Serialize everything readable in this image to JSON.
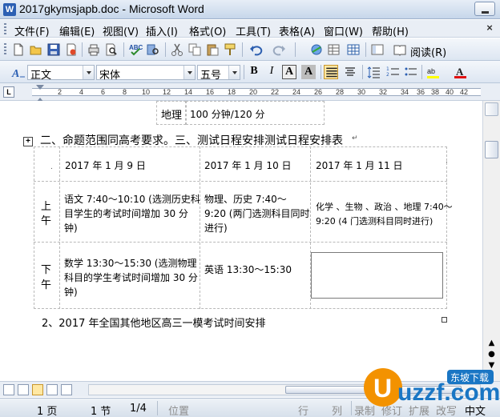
{
  "window": {
    "title": "2017gkymsjapb.doc - Microsoft Word",
    "app_icon": "W"
  },
  "menu": {
    "items": [
      "文件(F)",
      "编辑(E)",
      "视图(V)",
      "插入(I)",
      "格式(O)",
      "工具(T)",
      "表格(A)",
      "窗口(W)",
      "帮助(H)"
    ],
    "close": "×"
  },
  "toolbar": {
    "read_label": "阅读(R)"
  },
  "format_bar": {
    "style": "正文",
    "font": "宋体",
    "size": "五号",
    "bold": "B",
    "italic": "I",
    "font_color_label": "A",
    "char_shade_label": "A"
  },
  "ruler": {
    "ticks": [
      "2",
      "4",
      "6",
      "8",
      "10",
      "12",
      "14",
      "16",
      "18",
      "20",
      "22",
      "24",
      "26",
      "28",
      "30",
      "32",
      "34",
      "36",
      "38",
      "40",
      "42"
    ],
    "tab_marker": "L"
  },
  "document": {
    "prev_row": {
      "subject": "地理",
      "time": "100 分钟/120 分"
    },
    "heading": "二、命题范围同高考要求。三、测试日程安排测试日程安排表",
    "table_dates": [
      "2017 年 1 月 9 日",
      "2017 年 1 月 10 日",
      "2017 年 1 月 11 日"
    ],
    "morning_label": [
      "上",
      "午"
    ],
    "morning": [
      [
        "语文 7:40～10:10 (选测历史科",
        "目学生的考试时间增加 30 分",
        "钟)"
      ],
      [
        "物理、历史 7:40～",
        "9:20 (两门选测科目同时",
        "进行)"
      ],
      [
        "化学 、生物 、政治 、地理 7:40～",
        "9:20 (4 门选测科目同时进行)"
      ]
    ],
    "afternoon_label": [
      "下",
      "午"
    ],
    "afternoon": [
      [
        "数学 13:30～15:30 (选测物理",
        "科目的学生考试时间增加 30 分",
        "钟)"
      ],
      [
        "英语 13:30～15:30"
      ]
    ],
    "section2": "2、2017 年全国其他地区高三一模考试时间安排"
  },
  "status_bar": {
    "page": "1 页",
    "section": "1 节",
    "page_of": "1/4",
    "position": "位置",
    "line": "行",
    "column": "列",
    "rec": "录制",
    "trk": "修订",
    "ext": "扩展",
    "ovr": "改写",
    "lang": "中文"
  },
  "watermark": {
    "text": "uzzf.com",
    "badge": "东坡下载"
  },
  "colors": {
    "accent": "#2b5fb3",
    "watermark_orange": "#f39200",
    "watermark_blue": "#1a76c4"
  }
}
